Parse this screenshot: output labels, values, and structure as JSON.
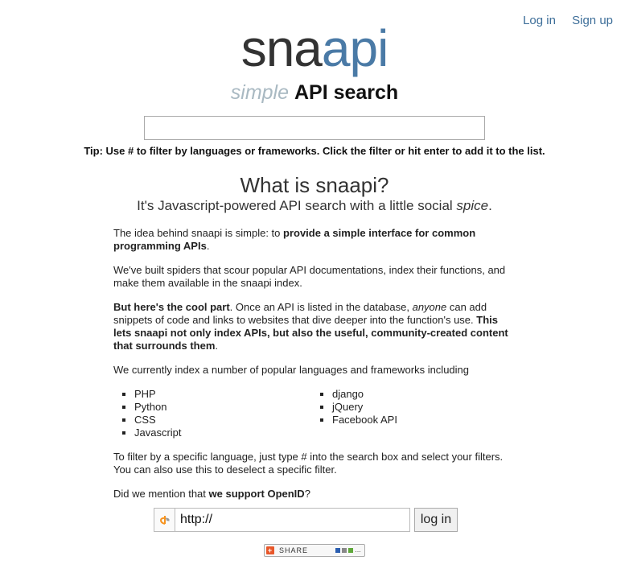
{
  "nav": {
    "login": "Log in",
    "signup": "Sign up"
  },
  "logo": {
    "part1": "sna",
    "part2": "api"
  },
  "tagline": {
    "simple": "simple",
    "rest": "API search"
  },
  "search": {
    "value": "",
    "placeholder": ""
  },
  "tip": "Tip: Use # to filter by languages or frameworks. Click the filter or hit enter to add it to the list.",
  "about": {
    "heading": "What is snaapi?",
    "sub1": "It's Javascript-powered API search with a little social ",
    "sub_em": "spice",
    "sub2": ".",
    "p1a": "The idea behind snaapi is simple: to ",
    "p1b": "provide a simple interface for common programming APIs",
    "p1c": ".",
    "p2": "We've built spiders that scour popular API documentations, index their functions, and make them available in the snaapi index.",
    "p3a": "But here's the cool part",
    "p3b": ". Once an API is listed in the database, ",
    "p3c": "anyone",
    "p3d": " can add snippets of code and links to websites that dive deeper into the function's use. ",
    "p3e": "This lets snaapi not only index APIs, but also the useful, community-created content that surrounds them",
    "p3f": ".",
    "p4": "We currently index a number of popular languages and frameworks including",
    "list_left": [
      "PHP",
      "Python",
      "CSS",
      "Javascript"
    ],
    "list_right": [
      "django",
      "jQuery",
      "Facebook API"
    ],
    "p5": "To filter by a specific language, just type # into the search box and select your filters. You can also use this to deselect a specific filter.",
    "p6a": "Did we mention that ",
    "p6b": "we support OpenID",
    "p6c": "?"
  },
  "openid": {
    "value": "http://",
    "button": "log in"
  },
  "share": {
    "label": "SHARE"
  },
  "colors": {
    "logo_dark": "#333333",
    "logo_blue": "#4a7aa6",
    "link": "#3d6e99",
    "simple": "#a9b9c2"
  }
}
